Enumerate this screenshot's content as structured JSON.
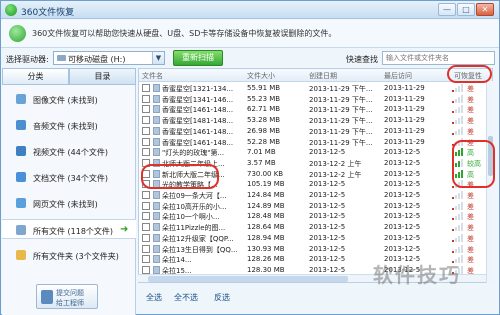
{
  "window": {
    "title": "360文件恢复",
    "minimize": "—",
    "maximize": "□",
    "close": "✕"
  },
  "info": {
    "text": "360文件恢复可以帮助您快速从硬盘、U盘、SD卡等存储设备中恢复被误删除的文件。"
  },
  "toolbar": {
    "drive_label": "选择驱动器:",
    "drive_value": "可移动磁盘 (H:)",
    "rescan": "重新扫描",
    "quick_search_label": "快速查找",
    "search_placeholder": "输入文件或文件夹名"
  },
  "left": {
    "tabs": [
      "分类",
      "目录"
    ],
    "categories": [
      {
        "label": "图像文件 (未找到)",
        "icon": "image-icon",
        "color": "#6aa3d8"
      },
      {
        "label": "音频文件 (未找到)",
        "icon": "music-icon",
        "color": "#4c8fd0"
      },
      {
        "label": "视频文件 (44个文件)",
        "icon": "video-icon",
        "color": "#3f7fc3"
      },
      {
        "label": "文档文件 (34个文件)",
        "icon": "document-icon",
        "color": "#4a90d9"
      },
      {
        "label": "网页文件 (未找到)",
        "icon": "webpage-icon",
        "color": "#5aa0dd"
      },
      {
        "label": "所有文件 (118个文件)",
        "icon": "all-files-icon",
        "color": "#7ea6cf"
      },
      {
        "label": "所有文件夹 (3个文件夹)",
        "icon": "folder-icon",
        "color": "#e8b94a"
      }
    ],
    "selected_arrow": "➜",
    "contact_line1": "提交问题",
    "contact_line2": "给工程师"
  },
  "grid": {
    "columns": [
      "文件名",
      "文件大小",
      "创建日期",
      "最后访问",
      "可恢复性"
    ],
    "rows": [
      {
        "name": "香蜜星空[1321-134...",
        "size": "55.91 MB",
        "created": "2013-11-29 下午...",
        "accessed": "2013-11-29",
        "rec": "差",
        "level": 1
      },
      {
        "name": "香蜜星空[1341-146...",
        "size": "55.23 MB",
        "created": "2013-11-29 下午...",
        "accessed": "2013-11-29",
        "rec": "差",
        "level": 1
      },
      {
        "name": "香蜜星空[1461-148...",
        "size": "62.71 MB",
        "created": "2013-11-29 下午...",
        "accessed": "2013-11-29",
        "rec": "差",
        "level": 1
      },
      {
        "name": "香蜜星空[1481-148...",
        "size": "53.28 MB",
        "created": "2013-11-29 下午...",
        "accessed": "2013-11-29",
        "rec": "差",
        "level": 1
      },
      {
        "name": "香蜜星空[1461-148...",
        "size": "26.98 MB",
        "created": "2013-11-29 下午...",
        "accessed": "2013-11-29",
        "rec": "差",
        "level": 1
      },
      {
        "name": "香蜜星空[1461-148...",
        "size": "52.28 MB",
        "created": "2013-11-29 下午...",
        "accessed": "2013-11-29",
        "rec": "差",
        "level": 1
      },
      {
        "name": "\"灯头的的玫瑰\"第...",
        "size": "7.01 MB",
        "created": "2013-12-5",
        "accessed": "2013-12-5",
        "rec": "高",
        "level": 4
      },
      {
        "name": "北师大版二年级上...",
        "size": "3.57 MB",
        "created": "2013-12-2 上午",
        "accessed": "2013-12-5",
        "rec": "较高",
        "level": 3
      },
      {
        "name": "新北师大版二年级...",
        "size": "730.00 KB",
        "created": "2013-12-2 上午",
        "accessed": "2013-12-5",
        "rec": "高",
        "level": 4
      },
      {
        "name": "光的教学策略【...",
        "size": "105.19 MB",
        "created": "2013-12-5",
        "accessed": "2013-12-5",
        "rec": "差",
        "level": 1
      },
      {
        "name": "朵拉09一条大河【...",
        "size": "124.84 MB",
        "created": "2013-12-5",
        "accessed": "2013-12-5",
        "rec": "差",
        "level": 1
      },
      {
        "name": "朵拉10高开乐的小...",
        "size": "124.89 MB",
        "created": "2013-12-5",
        "accessed": "2013-12-5",
        "rec": "差",
        "level": 1
      },
      {
        "name": "朵拉10一个啊小...",
        "size": "128.48 MB",
        "created": "2013-12-5",
        "accessed": "2013-12-5",
        "rec": "差",
        "level": 1
      },
      {
        "name": "朵拉11Pizzle的图...",
        "size": "128.64 MB",
        "created": "2013-12-5",
        "accessed": "2013-12-5",
        "rec": "差",
        "level": 1
      },
      {
        "name": "朵拉12升级家【QQP...",
        "size": "128.94 MB",
        "created": "2013-12-5",
        "accessed": "2013-12-5",
        "rec": "差",
        "level": 1
      },
      {
        "name": "朵拉13生日得到【QQ...",
        "size": "130.93 MB",
        "created": "2013-12-5",
        "accessed": "2013-12-5",
        "rec": "差",
        "level": 1
      },
      {
        "name": "朵拉14...",
        "size": "128.26 MB",
        "created": "2013-12-5",
        "accessed": "2013-12-5",
        "rec": "差",
        "level": 1
      },
      {
        "name": "朵拉15...",
        "size": "128.30 MB",
        "created": "2013-12-5",
        "accessed": "2013-12-5",
        "rec": "差",
        "level": 1
      }
    ]
  },
  "bottom": {
    "select_all": "全选",
    "select_none": "全不选",
    "invert": "反选"
  },
  "watermark": "软件技巧",
  "colors": {
    "good": "#2fa52f",
    "poor": "#c23a2a",
    "accent": "#2e86c1"
  }
}
